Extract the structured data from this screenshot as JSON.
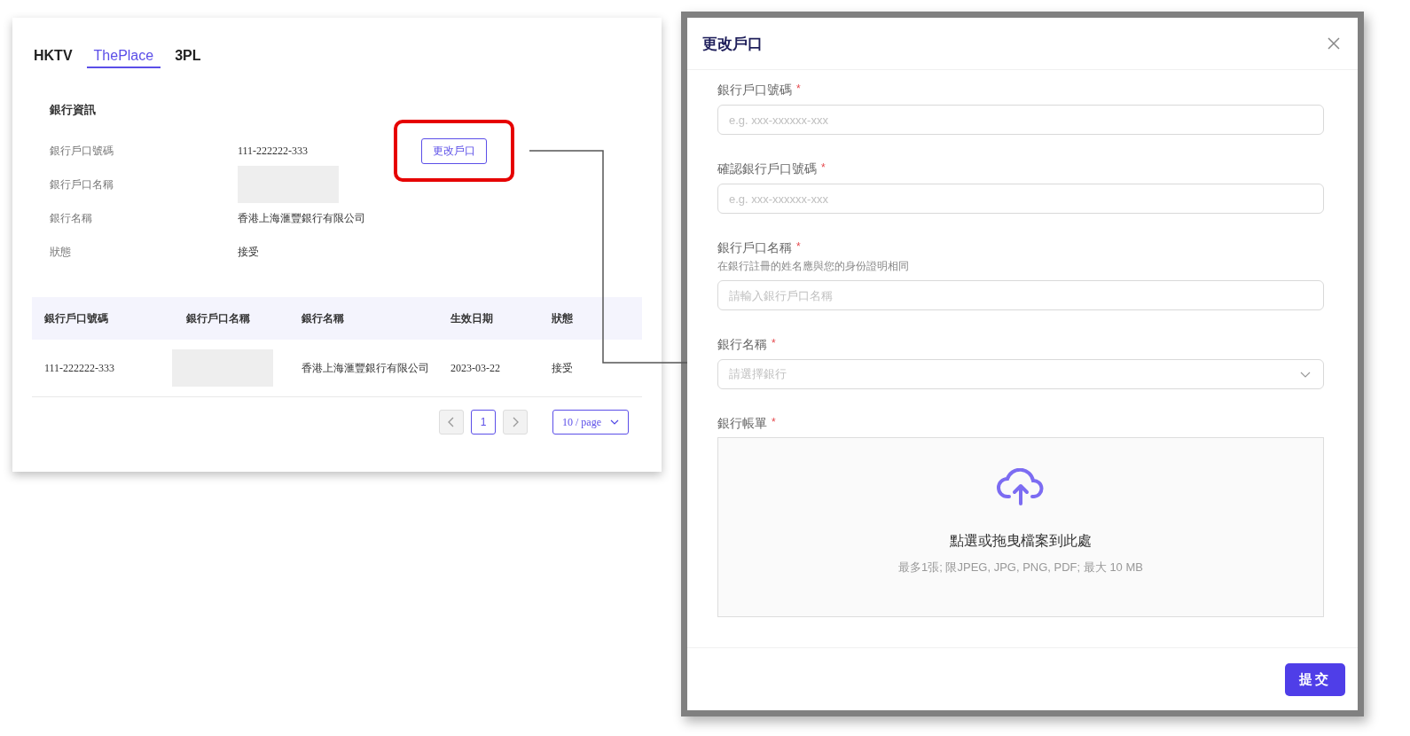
{
  "tabs": [
    {
      "label": "HKTV",
      "selected": false
    },
    {
      "label": "ThePlace",
      "selected": true
    },
    {
      "label": "3PL",
      "selected": false
    }
  ],
  "bank_info": {
    "title": "銀行資訊",
    "change_button": "更改戶口",
    "fields": [
      {
        "label": "銀行戶口號碼",
        "value": "111-222222-333"
      },
      {
        "label": "銀行戶口名稱"
      },
      {
        "label": "銀行名稱",
        "value": "香港上海滙豐銀行有限公司"
      },
      {
        "label": "狀態",
        "value": "接受"
      }
    ]
  },
  "table": {
    "columns": [
      "銀行戶口號碼",
      "銀行戶口名稱",
      "銀行名稱",
      "生效日期",
      "狀態"
    ],
    "rows": [
      {
        "cells": [
          "111-222222-333",
          null,
          "香港上海滙豐銀行有限公司",
          "2023-03-22",
          "接受"
        ]
      }
    ]
  },
  "pagination": {
    "pages": [
      {
        "label": "1",
        "selected": true
      }
    ],
    "page_size": "10 / page"
  },
  "dialog": {
    "title": "更改戶口",
    "fields": [
      {
        "kind": "input",
        "label": "銀行戶口號碼",
        "required_mark": "*",
        "placeholder": "e.g. xxx-xxxxxx-xxx"
      },
      {
        "kind": "input",
        "label": "確認銀行戶口號碼",
        "required_mark": "*",
        "placeholder": "e.g. xxx-xxxxxx-xxx"
      },
      {
        "kind": "input",
        "label": "銀行戶口名稱",
        "required_mark": "*",
        "hint": "在銀行註冊的姓名應與您的身份證明相同",
        "placeholder": "請輸入銀行戶口名稱"
      },
      {
        "kind": "select",
        "label": "銀行名稱",
        "required_mark": "*",
        "placeholder": "請選擇銀行"
      },
      {
        "kind": "upload",
        "label": "銀行帳單",
        "required_mark": "*",
        "prompt": "點選或拖曳檔案到此處",
        "note": "最多1張; 限JPEG, JPG, PNG, PDF; 最大 10 MB"
      }
    ],
    "submit": "提交"
  }
}
